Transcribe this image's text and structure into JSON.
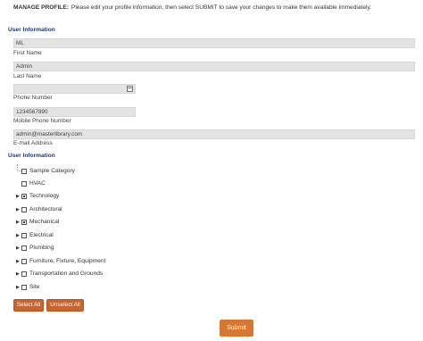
{
  "intro": {
    "title": "MANAGE PROFILE:",
    "text": "Please edit your profile information, then select SUBMIT to save your changes to make them available immediately."
  },
  "user_info": {
    "heading": "User Information",
    "first_name": {
      "value": "ML",
      "label": "First Name"
    },
    "last_name": {
      "value": "Admin",
      "label": "Last Name"
    },
    "phone": {
      "value": "",
      "label": "Phone Number"
    },
    "mobile": {
      "value": "1234567890",
      "label": "Mobile Phone Number"
    },
    "email": {
      "value": "admin@masterlibrary.com",
      "label": "E-mail Address"
    }
  },
  "categories": {
    "heading": "User Information",
    "items": [
      {
        "label": "Sample Category",
        "expandable": false,
        "state": "unchecked"
      },
      {
        "label": "HVAC",
        "expandable": false,
        "state": "unchecked"
      },
      {
        "label": "Technology",
        "expandable": true,
        "state": "partial"
      },
      {
        "label": "Architectural",
        "expandable": true,
        "state": "unchecked"
      },
      {
        "label": "Mechanical",
        "expandable": true,
        "state": "partial"
      },
      {
        "label": "Electrical",
        "expandable": true,
        "state": "unchecked"
      },
      {
        "label": "Plumbing",
        "expandable": true,
        "state": "unchecked"
      },
      {
        "label": "Furniture, Fixture, Equipment",
        "expandable": true,
        "state": "unchecked"
      },
      {
        "label": "Transportation and Grounds",
        "expandable": true,
        "state": "unchecked"
      },
      {
        "label": "Site",
        "expandable": true,
        "state": "unchecked"
      }
    ]
  },
  "buttons": {
    "select_all": "Select All",
    "unselect_all": "Unselect All",
    "submit": "Submit"
  },
  "colors": {
    "accent": "#c8642e",
    "heading": "#1f3a6b",
    "field_bg": "#e3e3e3"
  }
}
